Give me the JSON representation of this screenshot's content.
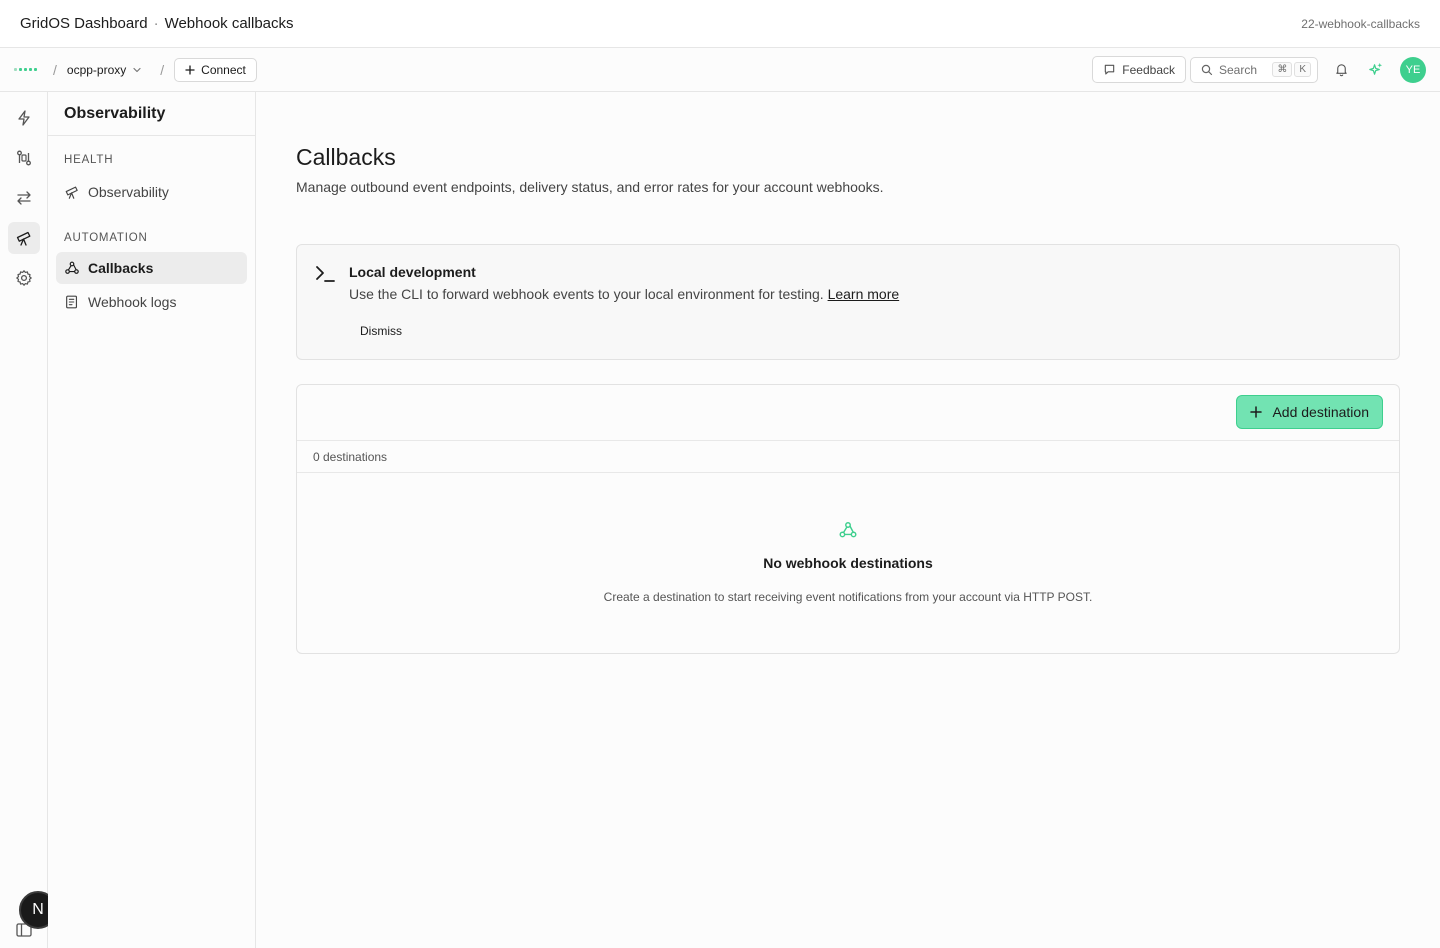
{
  "window": {
    "app_title": "GridOS Dashboard",
    "separator": "·",
    "page_title": "Webhook callbacks",
    "slug": "22-webhook-callbacks"
  },
  "topnav": {
    "slash": "/",
    "project": "ocpp-proxy",
    "connect_label": "Connect",
    "feedback_label": "Feedback",
    "search_placeholder": "Search",
    "search_kbd_1": "⌘",
    "search_kbd_2": "K",
    "avatar_initials": "YE"
  },
  "rail": {
    "badge_letter": "N"
  },
  "sidebar": {
    "title": "Observability",
    "sections": [
      {
        "label": "HEALTH",
        "items": [
          {
            "label": "Observability",
            "icon": "telescope-icon"
          }
        ]
      },
      {
        "label": "AUTOMATION",
        "items": [
          {
            "label": "Callbacks",
            "icon": "webhook-icon",
            "active": true
          },
          {
            "label": "Webhook logs",
            "icon": "logs-icon"
          }
        ]
      }
    ]
  },
  "main": {
    "title": "Callbacks",
    "subtitle": "Manage outbound event endpoints, delivery status, and error rates for your account webhooks.",
    "callout": {
      "title": "Local development",
      "body": "Use the CLI to forward webhook events to your local environment for testing.",
      "link": "Learn more",
      "dismiss": "Dismiss"
    },
    "table": {
      "add_label": "Add destination",
      "count_label": "0 destinations",
      "empty_title": "No webhook destinations",
      "empty_body": "Create a destination to start receiving event notifications from your account via HTTP POST."
    }
  },
  "colors": {
    "brand": "#3ecf8e",
    "brand_button": "#72e3b2"
  }
}
